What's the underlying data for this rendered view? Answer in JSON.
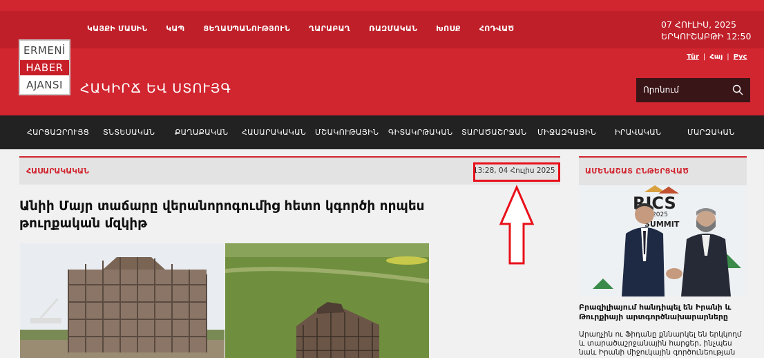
{
  "header": {
    "top_nav": [
      "ԿԱՅՔԻ ՄԱՍԻՆ",
      "ԿԱՊ",
      "ՑԵՂԱՍՊԱՆՈՒԹՅՈՒՆ",
      "ՂԱՐԱԲԱՂ",
      "ՌԱԶՄԱԿԱՆ",
      "ԽՈՍՔ",
      "ՀՈԴՎԱԾ"
    ],
    "date_line": "07 ՀՈՒԼԻՍ, 2025",
    "day_time_line": "ԵՐԿՈՒՇԱԲԹԻ 12:50",
    "languages": [
      "Tür",
      "Հայ",
      "Рус"
    ],
    "logo": {
      "line1": "ERMENİ",
      "line2": "HABER",
      "line3": "AJANSI"
    },
    "tagline": "ՀԱԿԻՐՃ ԵՎ ՍՏՈՒՅԳ",
    "search_placeholder": "Որոնում"
  },
  "main_nav": [
    "ՀԱՐՑԱԶՐՈՒՅՑ",
    "ՏՆՏԵՍԱԿԱՆ",
    "ՔԱՂԱՔԱԿԱՆ",
    "ՀԱՍԱՐԱԿԱԿԱՆ",
    "ՄՇԱԿՈՒԹԱՅԻՆ",
    "ԳԻՏԱԿՐԹԱԿԱՆ",
    "ՏԱՐԱԾԱՇՐՋԱՆ",
    "ՄԻՋԱԶԳԱՅԻՆ",
    "ԻՐԱՎԱԿԱՆ",
    "ՄԱՐԶԱԿԱՆ"
  ],
  "article": {
    "category": "ՀԱՍԱՐԱԿԱԿԱՆ",
    "date": "13:28, 04 Հուլիս 2025",
    "title": "Անիի Մայր տաճարը վերանորոգումից հետո կգործի որպես թուրքական մզկիթ"
  },
  "sidebar": {
    "heading": "ԱՄԵՆԱՇԱՏ ԸՆԹԵՐՑՎԱԾ",
    "photo_text": {
      "brand": "RICS",
      "sub": "asil 2025",
      "summit": "SUMMIT"
    },
    "title": "Բրազիլիայում հանդիպել են Իրանի և Թուրքիայի արտգործնախարարները",
    "description": "Արաղչին ու Ֆիդանը քննարկել են երկկողմ և տարածաշրջանային հարցեր, ինչպես նաև Իրանի միջուկային գործունեության հետ"
  },
  "colors": {
    "brand_red": "#d1252f",
    "nav_dark": "#222222",
    "highlight": "#e8101a"
  }
}
